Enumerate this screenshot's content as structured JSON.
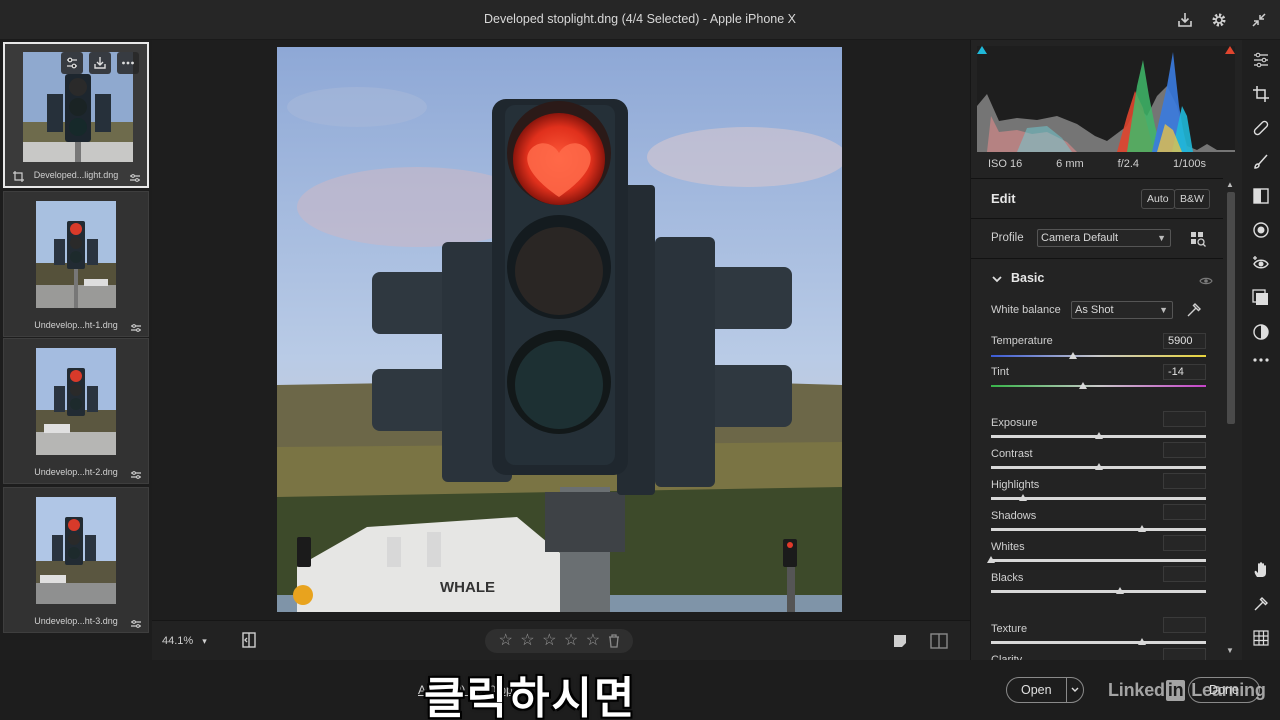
{
  "window": {
    "title": "Developed stoplight.dng (4/4 Selected)  -  Apple iPhone X"
  },
  "filmstrip": {
    "items": [
      {
        "filename": "Developed...light.dng",
        "selected": true
      },
      {
        "filename": "Undevelop...ht-1.dng",
        "selected": false
      },
      {
        "filename": "Undevelop...ht-2.dng",
        "selected": false
      },
      {
        "filename": "Undevelop...ht-3.dng",
        "selected": false
      }
    ]
  },
  "canvas": {
    "zoom": "44.1%",
    "rating_stars": 0
  },
  "status": {
    "info_text": "A... (...P) - 300 ppi",
    "open_label": "Open",
    "done_label": "Done",
    "watermark_left": "Linked",
    "watermark_in": "in",
    "watermark_right": " Learning",
    "caption": "클릭하시면"
  },
  "panel": {
    "exif": [
      "ISO 16",
      "6 mm",
      "f/2.4",
      "1/100s"
    ],
    "edit_title": "Edit",
    "auto_label": "Auto",
    "bw_label": "B&W",
    "profile_label": "Profile",
    "profile_value": "Camera Default",
    "basic_title": "Basic",
    "wb_label": "White balance",
    "wb_value": "As Shot",
    "temperature_label": "Temperature",
    "temperature_value": "5900",
    "tint_label": "Tint",
    "tint_value": "-14",
    "sliders": [
      {
        "label": "Exposure",
        "value": "",
        "pos": 0.5
      },
      {
        "label": "Contrast",
        "value": "",
        "pos": 0.5
      },
      {
        "label": "Highlights",
        "value": "",
        "pos": 0.15
      },
      {
        "label": "Shadows",
        "value": "",
        "pos": 0.7
      },
      {
        "label": "Whites",
        "value": "",
        "pos": 0.0
      },
      {
        "label": "Blacks",
        "value": "",
        "pos": 0.6
      },
      {
        "label": "Texture",
        "value": "",
        "pos": 0.7
      },
      {
        "label": "Clarity",
        "value": "",
        "pos": 0.5
      }
    ],
    "temperature_pos": 0.38,
    "tint_pos": 0.43
  },
  "colors": {
    "accent_cyan": "#1fb8d8",
    "accent_red": "#e0452e"
  }
}
